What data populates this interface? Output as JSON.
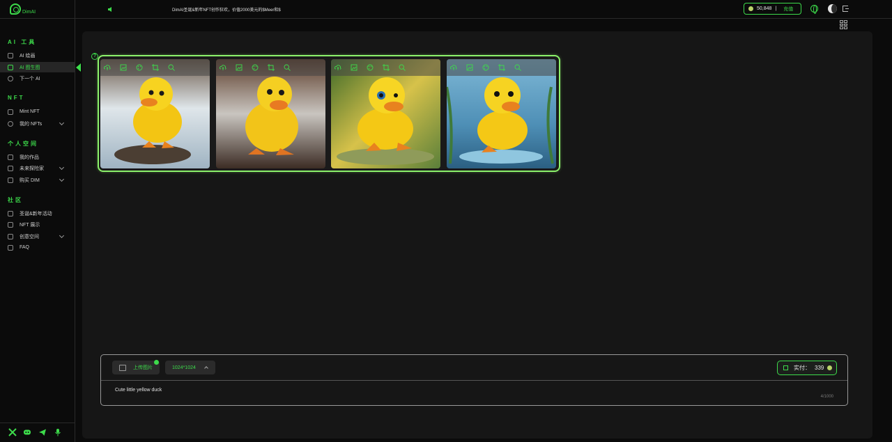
{
  "brand": {
    "name": "DimAI"
  },
  "header": {
    "announcement": "DimAI圣诞&新年NFT创作狂欢，价值2000美元的$Meer和$",
    "balance": "50,848",
    "separator": "|",
    "recharge_label": "充值"
  },
  "sidebar": {
    "sections": [
      {
        "title": "AI 工具",
        "items": [
          {
            "label": "AI 绘画",
            "icon": "image-icon"
          },
          {
            "label": "AI 图生图",
            "icon": "image-swap-icon",
            "active": true
          },
          {
            "label": "下一个 AI",
            "icon": "info-icon"
          }
        ]
      },
      {
        "title": "NFT",
        "items": [
          {
            "label": "Mint NFT",
            "icon": "mint-icon"
          },
          {
            "label": "我的 NFTs",
            "icon": "nft-icon",
            "has_submenu": true
          }
        ]
      },
      {
        "title": "个人空间",
        "items": [
          {
            "label": "我的作品",
            "icon": "cube-icon"
          },
          {
            "label": "未来探险家",
            "icon": "explorer-icon",
            "has_submenu": true
          },
          {
            "label": "购买 DIM",
            "icon": "cart-icon",
            "has_submenu": true
          }
        ]
      },
      {
        "title": "社区",
        "items": [
          {
            "label": "圣诞&新年活动",
            "icon": "calendar-icon"
          },
          {
            "label": "NFT 展示",
            "icon": "gallery-icon"
          },
          {
            "label": "创意空间",
            "icon": "space-icon",
            "has_submenu": true
          },
          {
            "label": "FAQ",
            "icon": "faq-icon"
          }
        ]
      }
    ],
    "socials": [
      "x-icon",
      "discord-icon",
      "telegram-icon",
      "microphone-icon"
    ]
  },
  "gallery": {
    "help_label": "?",
    "images": [
      {
        "alt": "duckling-1"
      },
      {
        "alt": "duckling-2"
      },
      {
        "alt": "duckling-3"
      },
      {
        "alt": "duckling-4"
      }
    ],
    "tools": [
      "upload-cloud-icon",
      "add-image-icon",
      "palette-icon",
      "crop-icon",
      "zoom-icon"
    ]
  },
  "prompt": {
    "upload_label": "上传图片",
    "size_label": "1024*1024",
    "pay_label": "实付：",
    "pay_value": "339",
    "text": "Cute little yellow duck",
    "counter": "4/1000"
  },
  "colors": {
    "accent": "#3ddc4b",
    "glow_border": "#8cf26b",
    "background": "#0b0b0b",
    "panel": "#161616"
  }
}
